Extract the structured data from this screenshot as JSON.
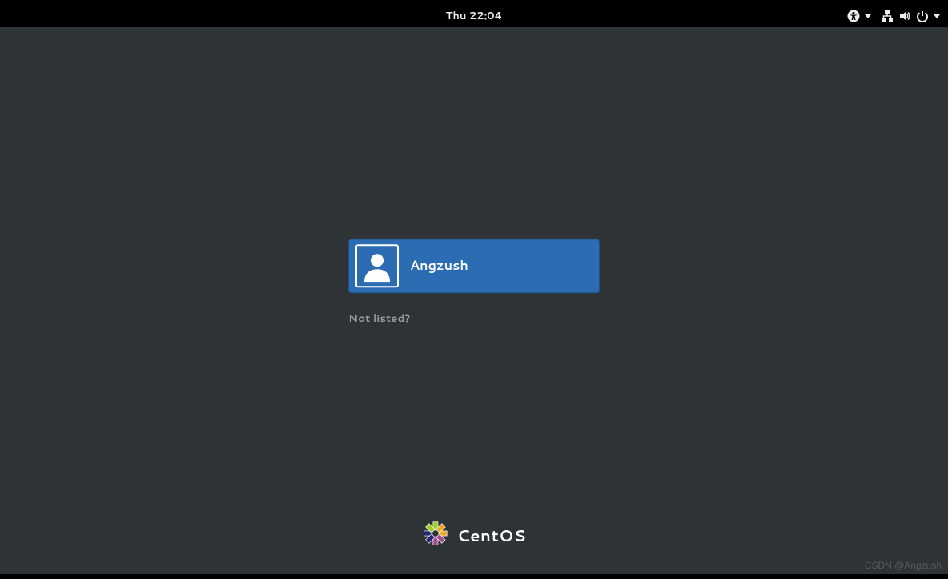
{
  "topbar": {
    "clock": "Thu 22:04"
  },
  "login": {
    "users": [
      {
        "name": "Angzush"
      }
    ],
    "not_listed_label": "Not listed?"
  },
  "branding": {
    "distro_name": "CentOS"
  },
  "watermark": "CSDN @Angzush"
}
